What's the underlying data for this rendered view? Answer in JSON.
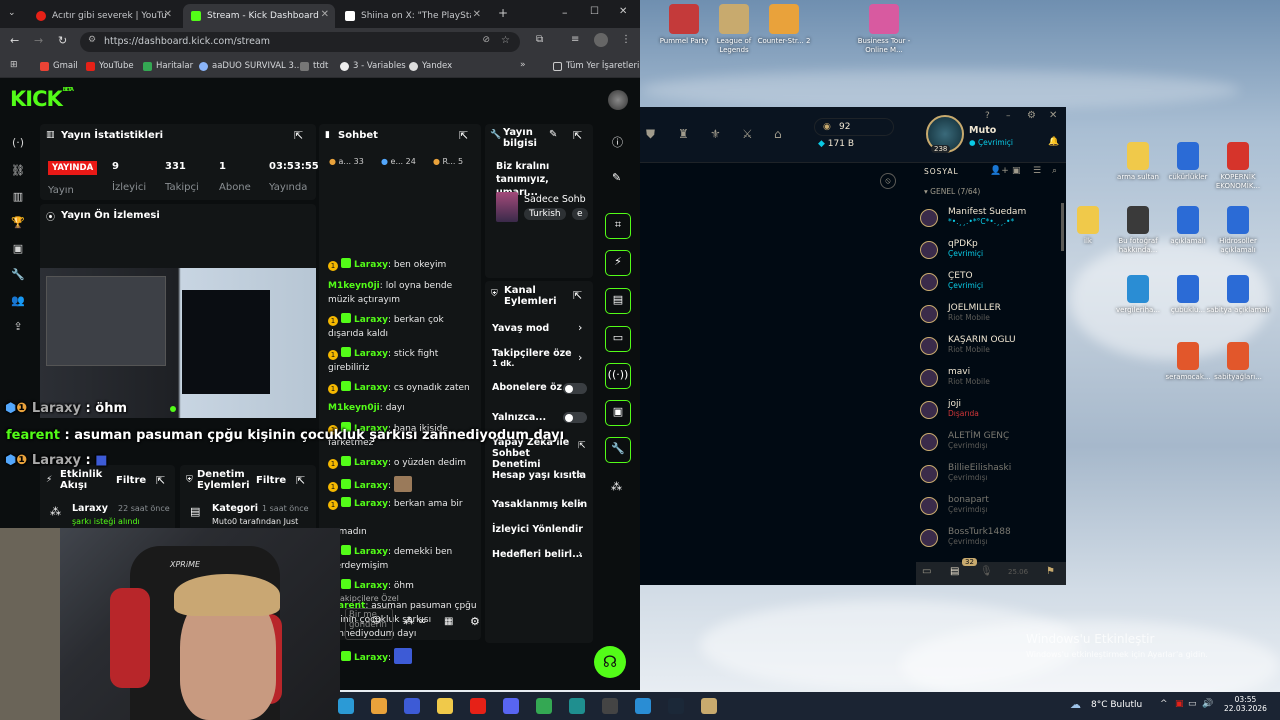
{
  "browser": {
    "tabs": [
      {
        "title": "Acıtır gibi severek | YouTu",
        "favicon": "#e62117"
      },
      {
        "title": "Stream - Kick Dashboard",
        "favicon": "#53fc18",
        "active": true
      },
      {
        "title": "Shiina on X: \"The PlayStation 5",
        "favicon": "#000000"
      }
    ],
    "url": "https://dashboard.kick.com/stream",
    "bookmarks": [
      "Gmail",
      "YouTube",
      "Haritalar",
      "aaDUO SURVIVAL 3...",
      "ttdt",
      "3 - Variables",
      "Yandex"
    ],
    "all_bookmarks": "Tüm Yer İşaretleri"
  },
  "kick": {
    "logo": "KICK",
    "logo_beta": "BETA",
    "stats": {
      "title": "Yayın İstatistikleri",
      "live_badge": "YAYINDA",
      "live_label": "Yayın",
      "items": [
        {
          "value": "9",
          "label": "İzleyici"
        },
        {
          "value": "331",
          "label": "Takipçi"
        },
        {
          "value": "1",
          "label": "Abone"
        },
        {
          "value": "03:53:55",
          "label": "Yayında"
        }
      ]
    },
    "preview_title": "Yayın Ön İzlemesi",
    "chat": {
      "title": "Sohbet",
      "tabs": [
        {
          "label": "a...",
          "count": "33"
        },
        {
          "label": "e...",
          "count": "24"
        },
        {
          "label": "R...",
          "count": "5"
        }
      ],
      "messages": [
        {
          "user": "Laraxy",
          "text": "ben okeyim",
          "badge": true
        },
        {
          "user": "M1keyn0ji",
          "text": "lol oyna bende müzik açtırayım",
          "badge": false
        },
        {
          "user": "Laraxy",
          "text": "berkan çok dışarıda kaldı",
          "badge": true
        },
        {
          "user": "Laraxy",
          "text": "stick fight girebiliriz",
          "badge": true
        },
        {
          "user": "Laraxy",
          "text": "cs oynadık zaten",
          "badge": true
        },
        {
          "user": "M1keyn0ji",
          "text": "dayı",
          "badge": false
        },
        {
          "user": "Laraxy",
          "text": "bana ikiside farketmez",
          "badge": true
        },
        {
          "user": "Laraxy",
          "text": "o yüzden dedim",
          "badge": true
        },
        {
          "user": "Laraxy",
          "text": "",
          "badge": true
        },
        {
          "user": "Laraxy",
          "text": "berkan ama bir",
          "badge": true
        },
        {
          "user": "",
          "text": "açmadın",
          "badge": false
        },
        {
          "user": "Laraxy",
          "text": "demekki ben içerdeymişim",
          "badge": true
        },
        {
          "user": "Laraxy",
          "text": "öhm",
          "badge": true
        },
        {
          "user": "fearent",
          "text": "asuman pasuman çpğu kişinin çocukluk şarkısı zannediyodum dayı",
          "badge": false
        },
        {
          "user": "Laraxy",
          "text": "",
          "badge": true
        }
      ],
      "followers_only": "akipçilere Özel",
      "input_placeholder": "Bir me gönderin"
    },
    "stream_info": {
      "title": "Yayın bilgisi",
      "stream_title": "Biz kralını tanımıyız, umarı...",
      "category": "Sadece Sohb",
      "tags": [
        "Turkish",
        "e"
      ]
    },
    "channel_actions": {
      "title": "Kanal Eylemleri",
      "items": [
        {
          "label": "Yavaş mod",
          "type": "chevron"
        },
        {
          "label": "Takipçilere özel s",
          "sub": "1 dk.",
          "type": "chevron"
        },
        {
          "label": "Abonelere öz...",
          "type": "toggle"
        },
        {
          "label": "Yalnızca...",
          "type": "toggle"
        },
        {
          "label": "Yapay Zeka ile Sohbet Denetimi",
          "type": "external"
        },
        {
          "label": "Hesap yaşı kısıtla",
          "type": "chevron"
        },
        {
          "label": "Yasaklanmış kelin",
          "type": "chevron"
        },
        {
          "label": "İzleyici Yönlendir",
          "type": "none"
        },
        {
          "label": "Hedefleri belirl...",
          "type": "chevron"
        }
      ]
    },
    "activity": {
      "title": "Etkinlik Akışı",
      "filter": "Filtre",
      "user": "Laraxy",
      "time": "22 saat önce",
      "text": "şarkı isteği alındı"
    },
    "moderation": {
      "title": "Denetim Eylemleri",
      "filter": "Filtre",
      "user": "Kategori",
      "time": "1 saat önce",
      "text": "Muto0 tarafından Just"
    }
  },
  "overlay": {
    "line1_user": "Laraxy",
    "line1_text": ": öhm",
    "line2_user": "fearent",
    "line2_text": ": asuman pasuman çpğu kişinin çocukluk şarkısı zannediyodum dayı",
    "line3_user": "Laraxy",
    "line3_text": ":"
  },
  "lol": {
    "currency_rp": "92",
    "currency_be": "171 B",
    "player_name": "Muto",
    "player_level": "238",
    "player_status": "Çevrimiçi",
    "social_title": "SOSYAL",
    "group_title": "GENEL (7/64)",
    "friends": [
      {
        "name": "Manifest Suedam",
        "status": "*•.¸¸.•*°C*•.¸¸.•*",
        "color": "#0acbe6"
      },
      {
        "name": "qPDKp",
        "status": "Çevrimiçi",
        "color": "#0acbe6"
      },
      {
        "name": "ÇETO",
        "status": "Çevrimiçi",
        "color": "#0acbe6"
      },
      {
        "name": "JOELMILLER",
        "status": "Riot Mobile",
        "color": "#5c5b57"
      },
      {
        "name": "KAŞARIN OGLU",
        "status": "Riot Mobile",
        "color": "#5c5b57"
      },
      {
        "name": "mavi",
        "status": "Riot Mobile",
        "color": "#5c5b57"
      },
      {
        "name": "joji",
        "status": "Dışarıda",
        "color": "#d13639"
      },
      {
        "name": "ALETİM GENÇ",
        "status": "Çevrimdışı",
        "color": "#5c5b57"
      },
      {
        "name": "BillieEilishaski",
        "status": "Çevrimdışı",
        "color": "#5c5b57"
      },
      {
        "name": "bonapart",
        "status": "Çevrimdışı",
        "color": "#5c5b57"
      },
      {
        "name": "BossTurk1488",
        "status": "Çevrimdışı",
        "color": "#5c5b57"
      }
    ],
    "bottom_badge": "32",
    "version": "25.06"
  },
  "desktop_top": [
    {
      "label": "Pummel Party",
      "color": "#c43a3a"
    },
    {
      "label": "League of Legends",
      "color": "#c8aa6e"
    },
    {
      "label": "Counter-Str... 2",
      "color": "#e9a23b"
    },
    {
      "label": "Business Tour - Online M...",
      "color": "#d85aa0"
    }
  ],
  "desktop_right": [
    {
      "label": "arma sultan",
      "color": "#f0c94a"
    },
    {
      "label": "cükürlükler",
      "color": "#2b6bd6"
    },
    {
      "label": "KOPERNİK EKONOMİK...",
      "color": "#d6342b"
    },
    {
      "label": "ilk",
      "color": "#f0c94a"
    },
    {
      "label": "Bu fotoğraf hakkında...",
      "color": "#3a3a3a"
    },
    {
      "label": "açıklamalı",
      "color": "#2b6bd6"
    },
    {
      "label": "Hidrosoller açıklamalı",
      "color": "#2b6bd6"
    },
    {
      "label": "vergileriha...",
      "color": "#2a8dd4"
    },
    {
      "label": "çubuklu...",
      "color": "#2b6bd6"
    },
    {
      "label": "sabitya açıklamalı",
      "color": "#2b6bd6"
    },
    {
      "label": "seramocak...",
      "color": "#e2572b"
    },
    {
      "label": "sabityağları...",
      "color": "#e2572b"
    }
  ],
  "windows_activation": {
    "title": "Windows'u Etkinleştir",
    "sub": "Windows'u etkinleştirmek için Ayarlar'a gidin."
  },
  "taskbar": {
    "weather": "8°C Bulutlu",
    "time": "03:55",
    "date": "22.03.2026"
  }
}
